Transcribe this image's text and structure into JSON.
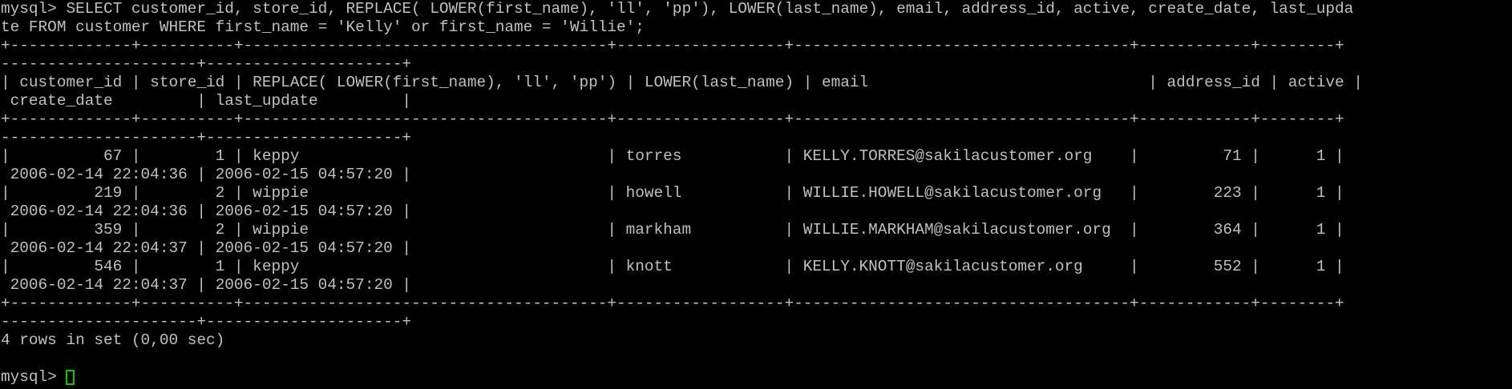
{
  "terminal": {
    "lines": [
      "mysql> SELECT customer_id, store_id, REPLACE( LOWER(first_name), 'll', 'pp'), LOWER(last_name), email, address_id, active, create_date, last_upda",
      "te FROM customer WHERE first_name = 'Kelly' or first_name = 'Willie';",
      "+-------------+----------+---------------------------------------+------------------+------------------------------------+------------+--------+",
      "---------------------+---------------------+",
      "| customer_id | store_id | REPLACE( LOWER(first_name), 'll', 'pp') | LOWER(last_name) | email                              | address_id | active |",
      " create_date         | last_update         |",
      "+-------------+----------+---------------------------------------+------------------+------------------------------------+------------+--------+",
      "---------------------+---------------------+",
      "|          67 |        1 | keppy                                 | torres           | KELLY.TORRES@sakilacustomer.org    |         71 |      1 |",
      " 2006-02-14 22:04:36 | 2006-02-15 04:57:20 |",
      "|         219 |        2 | wippie                                | howell           | WILLIE.HOWELL@sakilacustomer.org   |        223 |      1 |",
      " 2006-02-14 22:04:36 | 2006-02-15 04:57:20 |",
      "|         359 |        2 | wippie                                | markham          | WILLIE.MARKHAM@sakilacustomer.org  |        364 |      1 |",
      " 2006-02-14 22:04:37 | 2006-02-15 04:57:20 |",
      "|         546 |        1 | keppy                                 | knott            | KELLY.KNOTT@sakilacustomer.org     |        552 |      1 |",
      " 2006-02-14 22:04:37 | 2006-02-15 04:57:20 |",
      "+-------------+----------+---------------------------------------+------------------+------------------------------------+------------+--------+",
      "---------------------+---------------------+",
      "4 rows in set (0,00 sec)",
      ""
    ],
    "prompt": "mysql> "
  },
  "colors": {
    "background": "#000000",
    "text": "#c0c0c0",
    "cursor": "#00cc00"
  }
}
